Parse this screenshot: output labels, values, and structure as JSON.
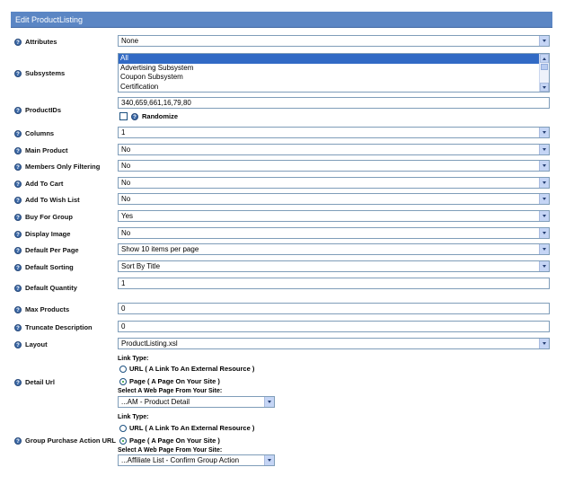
{
  "header": {
    "title": "Edit ProductListing"
  },
  "fields": {
    "attributes": {
      "label": "Attributes",
      "value": "None"
    },
    "subsystems": {
      "label": "Subsystems",
      "options": [
        "All",
        "Advertising Subsystem",
        "Coupon Subsystem",
        "Certification"
      ],
      "selected_index": 0
    },
    "product_ids": {
      "label": "ProductIDs",
      "value": "340,659,661,16,79,80",
      "randomize_label": "Randomize"
    },
    "columns": {
      "label": "Columns",
      "value": "1"
    },
    "main_product": {
      "label": "Main Product",
      "value": "No"
    },
    "members_only_filtering": {
      "label": "Members Only Filtering",
      "value": "No"
    },
    "add_to_cart": {
      "label": "Add To Cart",
      "value": "No"
    },
    "add_to_wish_list": {
      "label": "Add To Wish List",
      "value": "No"
    },
    "buy_for_group": {
      "label": "Buy For Group",
      "value": "Yes"
    },
    "display_image": {
      "label": "Display Image",
      "value": "No"
    },
    "default_per_page": {
      "label": "Default Per Page",
      "value": "Show 10 items per page"
    },
    "default_sorting": {
      "label": "Default Sorting",
      "value": "Sort By Title"
    },
    "default_quantity": {
      "label": "Default Quantity",
      "value": "1"
    },
    "max_products": {
      "label": "Max Products",
      "value": "0"
    },
    "truncate_description": {
      "label": "Truncate Description",
      "value": "0"
    },
    "layout": {
      "label": "Layout",
      "value": "ProductListing.xsl"
    },
    "detail_url": {
      "label": "Detail Url",
      "link_type_label": "Link Type:",
      "option_url": "URL ( A Link To An External Resource )",
      "option_page": "Page ( A Page On Your Site )",
      "selected": "page",
      "select_page_label": "Select A Web Page From Your Site:",
      "page_value": "...AM - Product Detail"
    },
    "group_purchase_action_url": {
      "label": "Group Purchase Action URL",
      "link_type_label": "Link Type:",
      "option_url": "URL ( A Link To An External Resource )",
      "option_page": "Page ( A Page On Your Site )",
      "selected": "page",
      "select_page_label": "Select A Web Page From Your Site:",
      "page_value": "...Affiliate List - Confirm Group Action"
    }
  },
  "icons": {
    "help": "help-icon",
    "dropdown": "chevron-down-icon"
  },
  "colors": {
    "header_bg": "#5b86c4",
    "selection": "#316ac5",
    "help_icon": "#3d6aa8"
  }
}
